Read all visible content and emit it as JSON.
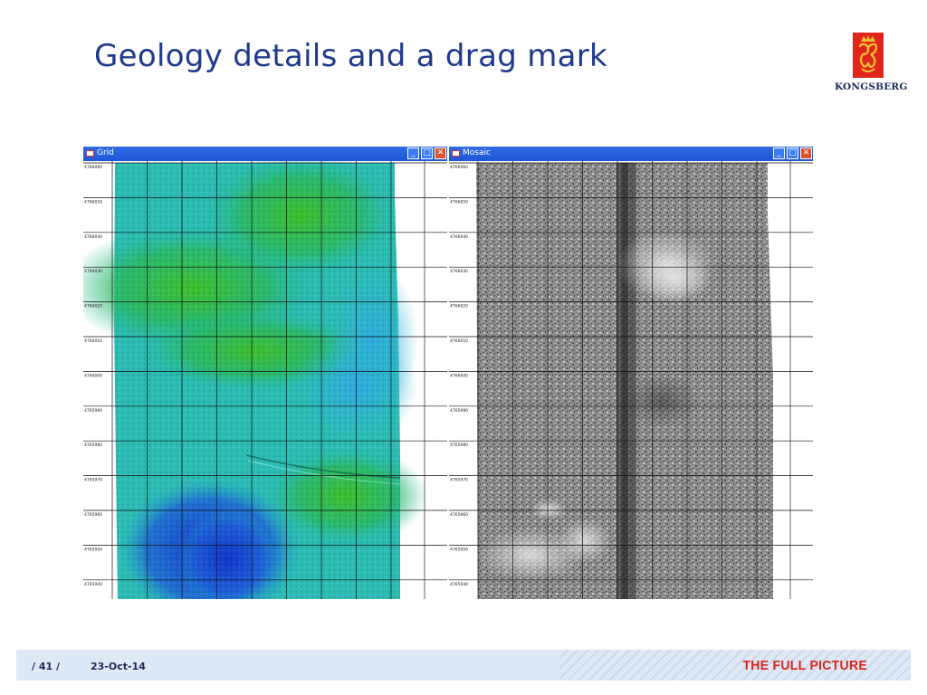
{
  "slide": {
    "title": "Geology details and a drag mark",
    "page_number": "/ 41 /",
    "date": "23-Oct-14",
    "tagline": "THE FULL PICTURE"
  },
  "logo": {
    "wordmark": "KONGSBERG",
    "icon": "kongsberg-crown-logo"
  },
  "windows": [
    {
      "title": "Grid",
      "kind": "color-bathymetry"
    },
    {
      "title": "Mosaic",
      "kind": "greyscale-backscatter"
    }
  ],
  "grid_labels": [
    "4766060",
    "4766050",
    "4766040",
    "4766030",
    "4766020",
    "4766010",
    "4766000",
    "4765990",
    "4765980",
    "4765970",
    "4765960",
    "4765950",
    "4765940"
  ],
  "colors": {
    "title": "#1f3a8a",
    "brand_red": "#d8241b",
    "titlebar": "#2f6be4"
  }
}
